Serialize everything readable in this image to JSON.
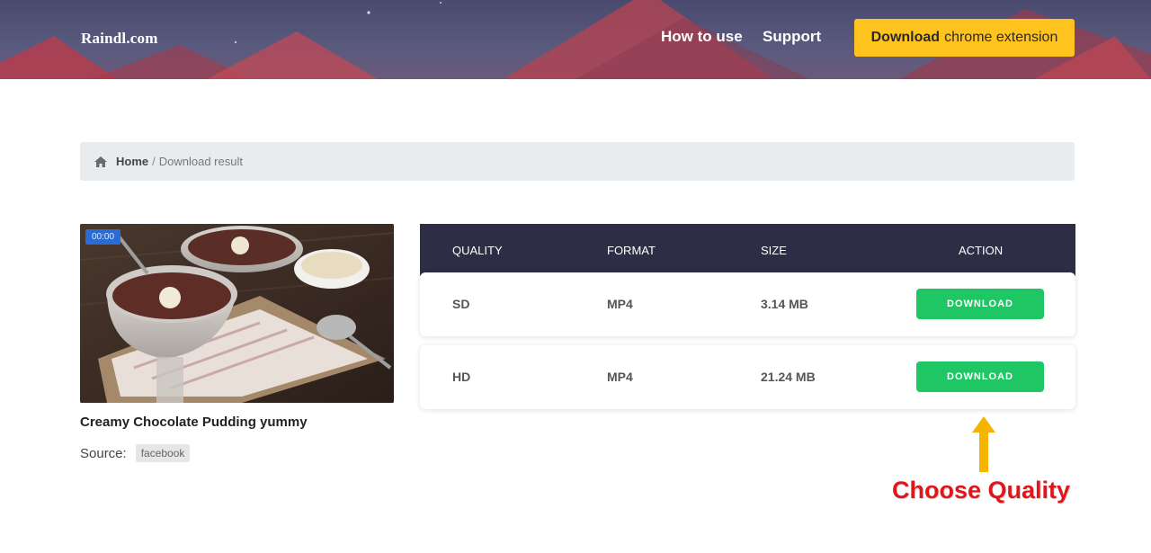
{
  "header": {
    "logo": "Raindl.com",
    "nav": {
      "how_to_use": "How to use",
      "support": "Support"
    },
    "extension_button": {
      "bold": "Download",
      "rest": "chrome extension"
    }
  },
  "breadcrumb": {
    "home": "Home",
    "separator": "/",
    "current": "Download result"
  },
  "video": {
    "duration": "00:00",
    "title": "Creamy Chocolate Pudding yummy",
    "source_label": "Source:",
    "source_value": "facebook"
  },
  "table": {
    "headers": {
      "quality": "QUALITY",
      "format": "FORMAT",
      "size": "SIZE",
      "action": "ACTION"
    },
    "rows": [
      {
        "quality": "SD",
        "format": "MP4",
        "size": "3.14 MB",
        "action": "DOWNLOAD"
      },
      {
        "quality": "HD",
        "format": "MP4",
        "size": "21.24 MB",
        "action": "DOWNLOAD"
      }
    ]
  },
  "annotation": {
    "text": "Choose Quality"
  },
  "colors": {
    "accent_yellow": "#ffc31f",
    "download_green": "#1ec764",
    "table_header": "#2d2d46",
    "annotation_red": "#e0161b"
  }
}
